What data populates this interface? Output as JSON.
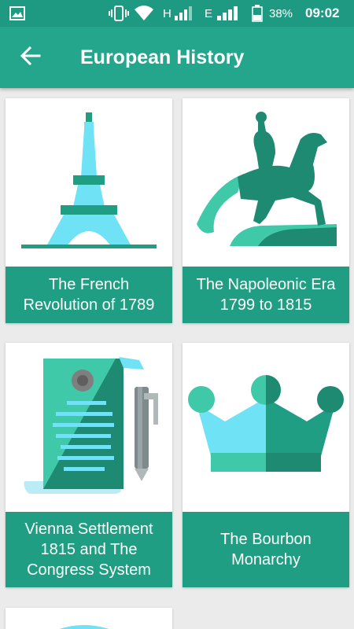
{
  "status_bar": {
    "network_h": "H",
    "network_e": "E",
    "battery": "38%",
    "time": "09:02"
  },
  "app_bar": {
    "title": "European History",
    "back_icon": "arrow-back-icon"
  },
  "cards": [
    {
      "title": "The French Revolution of 1789",
      "icon": "eiffel-tower-icon"
    },
    {
      "title": "The Napoleonic Era 1799 to 1815",
      "icon": "equestrian-statue-icon"
    },
    {
      "title": "Vienna Settlement 1815 and The Congress System",
      "icon": "treaty-scroll-pen-icon"
    },
    {
      "title": "The Bourbon Monarchy",
      "icon": "crown-icon"
    }
  ],
  "colors": {
    "primary": "#23a68b",
    "primary_dark": "#1f9a82",
    "caption_bg": "#1f9e84",
    "accent_light": "#6fe3f5",
    "accent_teal": "#40c9a8"
  }
}
